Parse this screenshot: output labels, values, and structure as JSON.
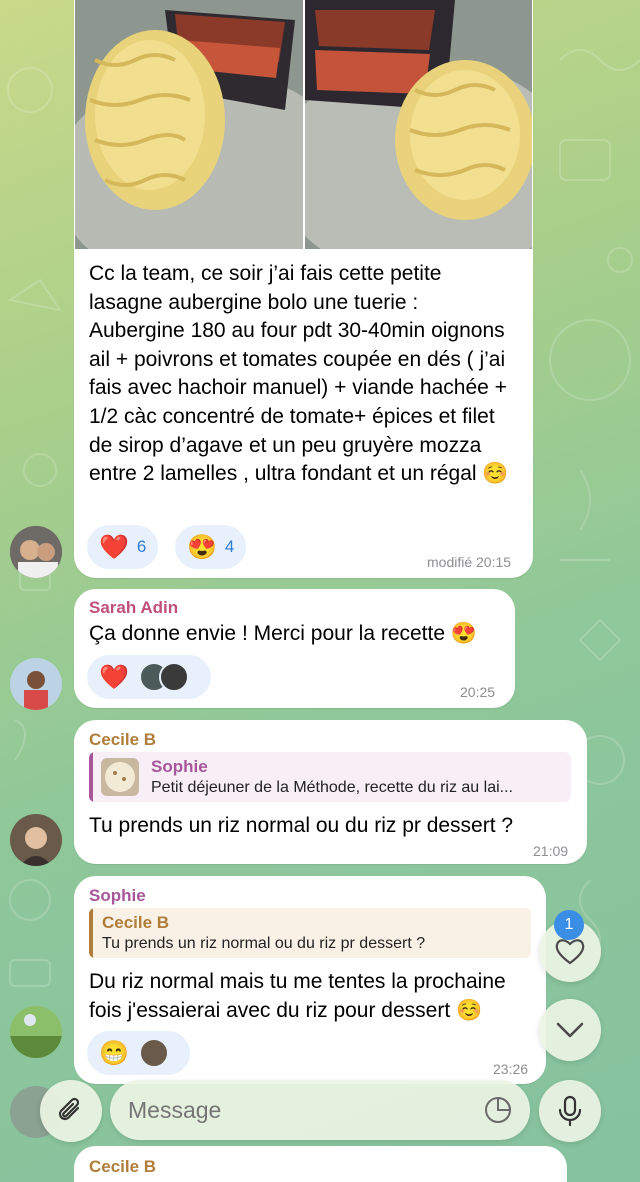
{
  "messages": [
    {
      "text": "Cc la team, ce soir j’ai fais cette petite lasagne aubergine bolo une tuerie :\nAubergine 180 au four pdt 30-40min oignons ail + poivrons et tomates coupée en dés ( j’ai fais avec hachoir manuel) + viande hachée + 1/2 càc concentré de tomate+ épices et filet de sirop d’agave et un peu gruyère mozza entre 2 lamelles , ultra fondant et un régal ☺️",
      "reactions": [
        {
          "emoji": "❤️",
          "count": "6"
        },
        {
          "emoji": "😍",
          "count": "4"
        }
      ],
      "time": "modifié 20:15"
    },
    {
      "sender": "Sarah Adin",
      "text": "Ça donne envie ! Merci pour la recette 😍",
      "reactions": [
        {
          "emoji": "❤️"
        }
      ],
      "time": "20:25"
    },
    {
      "sender": "Cecile B",
      "reply": {
        "author": "Sophie",
        "text": "Petit déjeuner de la Méthode, recette du riz au lai..."
      },
      "text": "Tu prends un riz normal ou du riz pr dessert ?",
      "time": "21:09"
    },
    {
      "sender": "Sophie",
      "reply": {
        "author": "Cecile B",
        "text": "Tu prends un riz normal ou du riz pr dessert ?"
      },
      "text": "Du riz normal mais tu me tentes la prochaine fois j'essaierai avec du riz pour dessert ☺️",
      "reactions": [
        {
          "emoji": "😁"
        }
      ],
      "time": "23:26"
    },
    {
      "sender": "Cecile B"
    }
  ],
  "reaction_badge": "1",
  "composer": {
    "placeholder": "Message"
  },
  "colors": {
    "sarah": "#c0507a",
    "cecile": "#b07d3a",
    "sophie": "#a8569a",
    "reaction_count": "#2e7dd6",
    "badge": "#3a8ee6"
  }
}
